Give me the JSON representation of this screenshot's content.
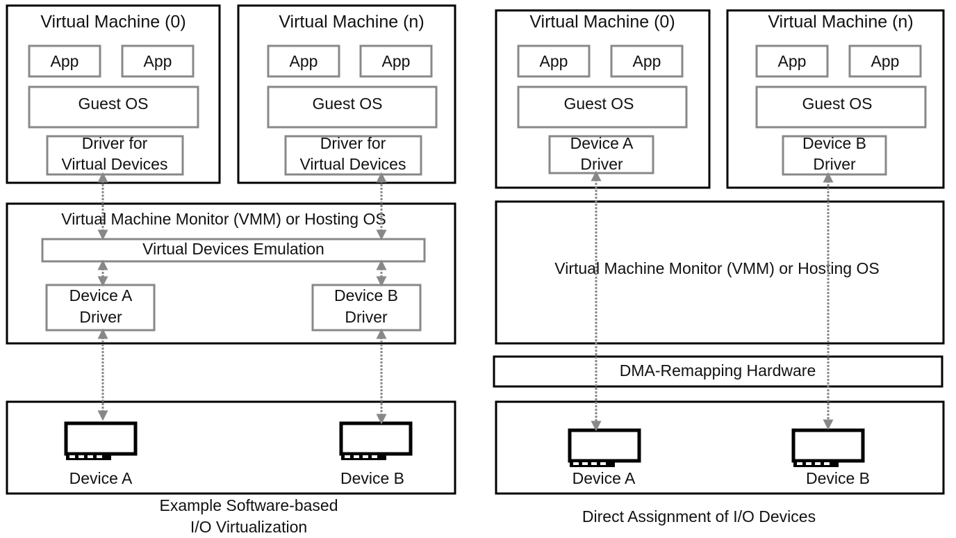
{
  "left": {
    "vm0": {
      "title": "Virtual Machine (0)",
      "app1": "App",
      "app2": "App",
      "guest_os": "Guest OS",
      "driver_l1": "Driver for",
      "driver_l2": "Virtual Devices"
    },
    "vmn": {
      "title": "Virtual Machine (n)",
      "app1": "App",
      "app2": "App",
      "guest_os": "Guest OS",
      "driver_l1": "Driver for",
      "driver_l2": "Virtual Devices"
    },
    "vmm": {
      "title": "Virtual Machine Monitor (VMM) or Hosting OS",
      "emulation": "Virtual Devices Emulation",
      "driver_a_l1": "Device A",
      "driver_a_l2": "Driver",
      "driver_b_l1": "Device B",
      "driver_b_l2": "Driver"
    },
    "hardware": {
      "device_a": "Device A",
      "device_b": "Device B"
    },
    "caption_l1": "Example Software-based",
    "caption_l2": "I/O Virtualization"
  },
  "right": {
    "vm0": {
      "title": "Virtual Machine (0)",
      "app1": "App",
      "app2": "App",
      "guest_os": "Guest OS",
      "driver_l1": "Device A",
      "driver_l2": "Driver"
    },
    "vmn": {
      "title": "Virtual Machine (n)",
      "app1": "App",
      "app2": "App",
      "guest_os": "Guest OS",
      "driver_l1": "Device B",
      "driver_l2": "Driver"
    },
    "vmm": {
      "title": "Virtual Machine Monitor (VMM) or Hosting OS"
    },
    "dma": "DMA-Remapping Hardware",
    "hardware": {
      "device_a": "Device A",
      "device_b": "Device B"
    },
    "caption": "Direct Assignment of I/O Devices"
  },
  "icons": {
    "device": "pci-card-icon",
    "arrow": "bidirectional-dotted-arrow"
  },
  "colors": {
    "outer_border": "#000000",
    "inner_border": "#888888",
    "arrow": "#888888"
  }
}
